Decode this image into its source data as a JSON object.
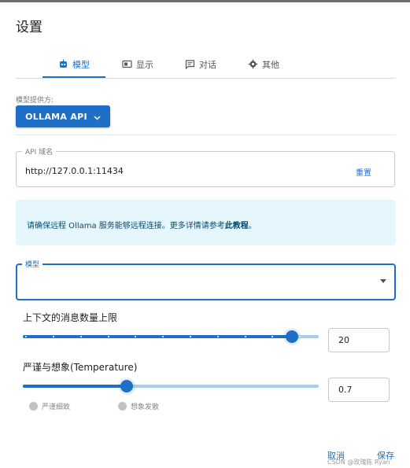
{
  "dialog": {
    "title": "设置"
  },
  "tabs": [
    {
      "label": "模型",
      "icon": "robot-icon",
      "active": true
    },
    {
      "label": "显示",
      "icon": "display-icon",
      "active": false
    },
    {
      "label": "对话",
      "icon": "chat-icon",
      "active": false
    },
    {
      "label": "其他",
      "icon": "gear-icon",
      "active": false
    }
  ],
  "provider": {
    "label": "模型提供方:",
    "value": "OLLAMA API"
  },
  "api": {
    "label": "API 域名",
    "value": "http://127.0.0.1:11434",
    "reset_label": "重置"
  },
  "info": {
    "text": "请确保远程 Ollama 服务能够远程连接。更多详情请参考",
    "link": "此教程",
    "suffix": "。"
  },
  "model": {
    "label": "模型",
    "value": ""
  },
  "context": {
    "title": "上下文的消息数量上限",
    "value": "20",
    "level": 0.91,
    "marks": 11
  },
  "temperature": {
    "title": "严谨与想象(Temperature)",
    "value": "0.7",
    "level": 0.35,
    "hint_left": "严谨细致",
    "hint_right": "想象发散"
  },
  "actions": {
    "cancel": "取消",
    "save": "保存"
  },
  "watermark": "CSDN @玫瑰陈 Ryan",
  "colors": {
    "accent": "#1e6fc7",
    "info_bg": "#e5f6fd"
  }
}
